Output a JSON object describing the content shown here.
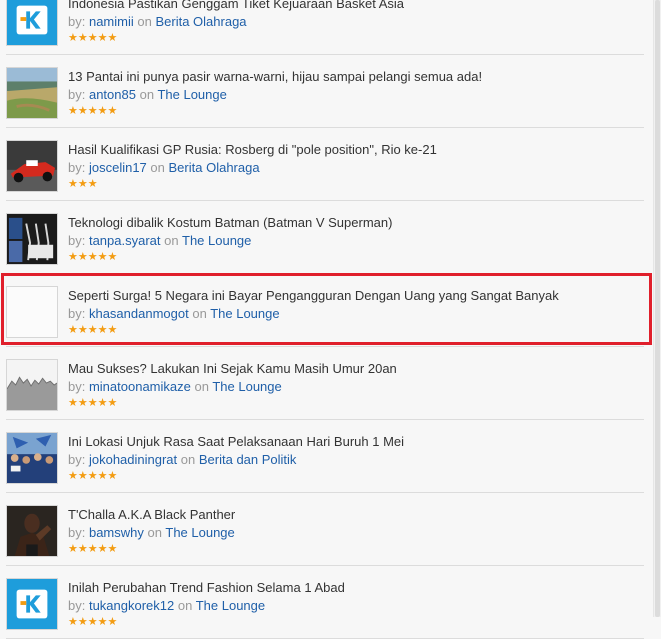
{
  "threads": [
    {
      "title": "Indonesia Pastikan Genggam Tiket Kejuaraan Basket Asia",
      "by": "by:",
      "author": "namimii",
      "on": "on",
      "forum": "Berita Olahraga",
      "rating": 5,
      "stars": "★★★★★",
      "thumb": "kaskus-logo"
    },
    {
      "title": "13 Pantai ini punya pasir warna-warni, hijau sampai pelangi semua ada!",
      "by": "by:",
      "author": "anton85",
      "on": "on",
      "forum": "The Lounge",
      "rating": 5,
      "stars": "★★★★★",
      "thumb": "beach-photo"
    },
    {
      "title": "Hasil Kualifikasi GP Rusia: Rosberg di \"pole position\", Rio ke-21",
      "by": "by:",
      "author": "joscelin17",
      "on": "on",
      "forum": "Berita Olahraga",
      "rating": 3,
      "stars": "★★★",
      "thumb": "f1-car-photo"
    },
    {
      "title": "Teknologi dibalik Kostum Batman (Batman V Superman)",
      "by": "by:",
      "author": "tanpa.syarat",
      "on": "on",
      "forum": "The Lounge",
      "rating": 5,
      "stars": "★★★★★",
      "thumb": "batman-suits-photo"
    },
    {
      "title": "Seperti Surga! 5 Negara ini Bayar Pengangguran Dengan Uang yang Sangat Banyak",
      "by": "by:",
      "author": "khasandanmogot",
      "on": "on",
      "forum": "The Lounge",
      "rating": 5,
      "stars": "★★★★★",
      "thumb": "blank-thumbnail"
    },
    {
      "title": "Mau Sukses? Lakukan Ini Sejak Kamu Masih Umur 20an",
      "by": "by:",
      "author": "minatoonamikaze",
      "on": "on",
      "forum": "The Lounge",
      "rating": 5,
      "stars": "★★★★★",
      "thumb": "chart-graphic"
    },
    {
      "title": "Ini Lokasi Unjuk Rasa Saat Pelaksanaan Hari Buruh 1 Mei",
      "by": "by:",
      "author": "jokohadiningrat",
      "on": "on",
      "forum": "Berita dan Politik",
      "rating": 5,
      "stars": "★★★★★",
      "thumb": "protest-photo"
    },
    {
      "title": "T'Challa A.K.A Black Panther",
      "by": "by:",
      "author": "bamswhy",
      "on": "on",
      "forum": "The Lounge",
      "rating": 5,
      "stars": "★★★★★",
      "thumb": "black-panther-photo"
    },
    {
      "title": "Inilah Perubahan Trend Fashion Selama 1 Abad",
      "by": "by:",
      "author": "tukangkorek12",
      "on": "on",
      "forum": "The Lounge",
      "rating": 5,
      "stars": "★★★★★",
      "thumb": "kaskus-logo"
    }
  ],
  "colors": {
    "link": "#1f5fa8",
    "star": "#f39c12",
    "highlight": "#e01f2b",
    "kaskus_blue": "#1e9ddb"
  }
}
